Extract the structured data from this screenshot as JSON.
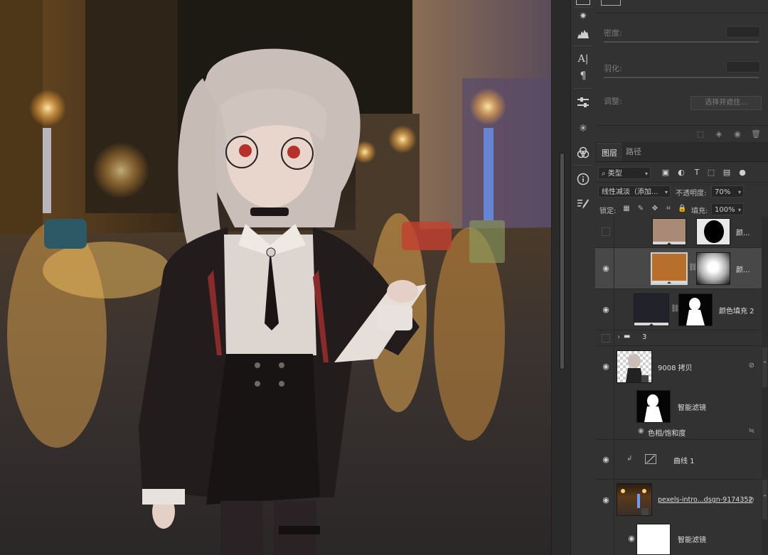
{
  "properties": {
    "density_label": "密度:",
    "feather_label": "羽化:",
    "adjust_label": "调整:",
    "select_mask_button": "选择并遮住..."
  },
  "layers_panel": {
    "tabs": [
      {
        "label": "图层",
        "active": true
      },
      {
        "label": "路径",
        "active": false
      }
    ],
    "filter_kind": "类型",
    "blend_mode": "线性减淡（添加...",
    "opacity_label": "不透明度:",
    "opacity_value": "70%",
    "lock_label": "锁定:",
    "fill_label": "填充:",
    "fill_value": "100%",
    "layers": [
      {
        "name": "颜...",
        "visible": false
      },
      {
        "name": "颜...",
        "visible": true,
        "selected": true
      },
      {
        "name": "颜色填充 2",
        "visible": true
      },
      {
        "name": "3",
        "type": "group",
        "visible": false
      },
      {
        "name": "9008 拷贝",
        "visible": true
      },
      {
        "name": "智能滤镜",
        "type": "smart-filter"
      },
      {
        "name": "色相/饱和度",
        "type": "filter-entry"
      },
      {
        "name": "曲线 1",
        "visible": true
      },
      {
        "name": "pexels-intro...dsgn-9174352",
        "visible": true
      },
      {
        "name": "智能滤镜",
        "type": "smart-filter",
        "visible": true
      }
    ]
  },
  "colors": {
    "fill_swatch_tan": "#a88a76",
    "fill_swatch_orange": "#b86f2c",
    "fill_swatch_dark": "#22232a",
    "selected_row": "#484848"
  }
}
